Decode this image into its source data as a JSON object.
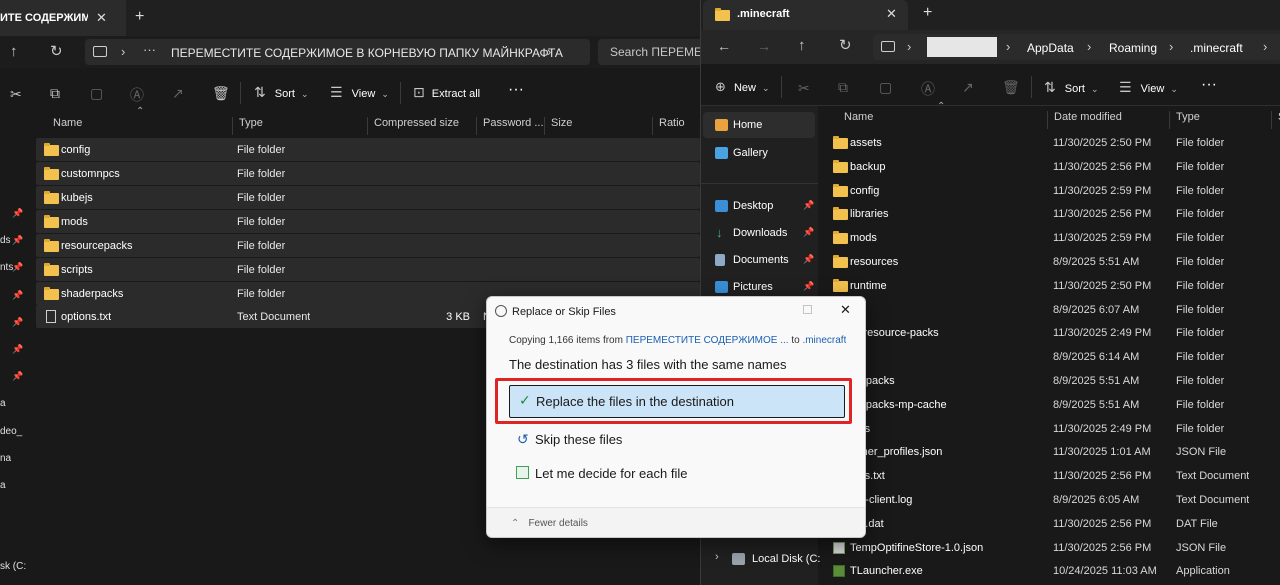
{
  "left": {
    "tab_title": "ИТЕ СОДЕРЖИМО",
    "address": "ПЕРЕМЕСТИТЕ СОДЕРЖИМОЕ В КОРНЕВУЮ ПАПКУ МАЙНКРАФТА",
    "search_placeholder": "Search ПЕРЕМЕС",
    "toolbar": {
      "sort": "Sort",
      "view": "View",
      "extract_all": "Extract all"
    },
    "columns": [
      "Name",
      "Type",
      "Compressed size",
      "Password ...",
      "Size",
      "Ratio"
    ],
    "rows": [
      {
        "name": "config",
        "type": "File folder",
        "size": "",
        "kind": "folder"
      },
      {
        "name": "customnpcs",
        "type": "File folder",
        "size": "",
        "kind": "folder"
      },
      {
        "name": "kubejs",
        "type": "File folder",
        "size": "",
        "kind": "folder"
      },
      {
        "name": "mods",
        "type": "File folder",
        "size": "",
        "kind": "folder"
      },
      {
        "name": "resourcepacks",
        "type": "File folder",
        "size": "",
        "kind": "folder"
      },
      {
        "name": "scripts",
        "type": "File folder",
        "size": "",
        "kind": "folder"
      },
      {
        "name": "shaderpacks",
        "type": "File folder",
        "size": "",
        "kind": "folder"
      },
      {
        "name": "options.txt",
        "type": "Text Document",
        "size": "3 KB",
        "kind": "file"
      }
    ],
    "sidebar_fragments": [
      "ds",
      "nts",
      "a",
      "deo_",
      "na",
      "a",
      "sk (C:"
    ],
    "row_extra": "N"
  },
  "right": {
    "tab_title": ".minecraft",
    "breadcrumb": [
      "AppData",
      "Roaming",
      ".minecraft"
    ],
    "toolbar": {
      "new": "New",
      "sort": "Sort",
      "view": "View"
    },
    "columns": [
      "Name",
      "Date modified",
      "Type",
      "S"
    ],
    "sidebar": [
      {
        "label": "Home",
        "icon": "home-icon",
        "color": "#e8a33d"
      },
      {
        "label": "Gallery",
        "icon": "gallery-icon",
        "color": "#4aa3e0"
      },
      {
        "label": "Desktop",
        "icon": "desktop-icon",
        "color": "#3a8fd8"
      },
      {
        "label": "Downloads",
        "icon": "downloads-icon",
        "color": "#3fb27f"
      },
      {
        "label": "Documents",
        "icon": "documents-icon",
        "color": "#8fa9c8"
      },
      {
        "label": "Pictures",
        "icon": "pictures-icon",
        "color": "#3a8fd8"
      },
      {
        "label": "Local Disk (C:",
        "icon": "disk-icon",
        "color": "#9aa3ad"
      }
    ],
    "rows": [
      {
        "name": "assets",
        "date": "11/30/2025 2:50 PM",
        "type": "File folder",
        "kind": "folder"
      },
      {
        "name": "backup",
        "date": "11/30/2025 2:56 PM",
        "type": "File folder",
        "kind": "folder"
      },
      {
        "name": "config",
        "date": "11/30/2025 2:59 PM",
        "type": "File folder",
        "kind": "folder"
      },
      {
        "name": "libraries",
        "date": "11/30/2025 2:56 PM",
        "type": "File folder",
        "kind": "folder"
      },
      {
        "name": "mods",
        "date": "11/30/2025 2:59 PM",
        "type": "File folder",
        "kind": "folder"
      },
      {
        "name": "resources",
        "date": "8/9/2025 5:51 AM",
        "type": "File folder",
        "kind": "folder"
      },
      {
        "name": "runtime",
        "date": "11/30/2025 2:50 PM",
        "type": "File folder",
        "kind": "folder"
      },
      {
        "name": "es",
        "date": "8/9/2025 6:07 AM",
        "type": "File folder",
        "kind": "hidden"
      },
      {
        "name": "er-resource-packs",
        "date": "11/30/2025 2:49 PM",
        "type": "File folder",
        "kind": "hidden"
      },
      {
        "name": "s",
        "date": "8/9/2025 6:14 AM",
        "type": "File folder",
        "kind": "hidden"
      },
      {
        "name": "urepacks",
        "date": "8/9/2025 5:51 AM",
        "type": "File folder",
        "kind": "hidden"
      },
      {
        "name": "urepacks-mp-cache",
        "date": "8/9/2025 5:51 AM",
        "type": "File folder",
        "kind": "hidden"
      },
      {
        "name": "ions",
        "date": "11/30/2025 2:49 PM",
        "type": "File folder",
        "kind": "hidden"
      },
      {
        "name": "ncher_profiles.json",
        "date": "11/30/2025 1:01 AM",
        "type": "JSON File",
        "kind": "hidden"
      },
      {
        "name": "ions.txt",
        "date": "11/30/2025 2:56 PM",
        "type": "Text Document",
        "kind": "hidden"
      },
      {
        "name": "put-client.log",
        "date": "8/9/2025 6:05 AM",
        "type": "Text Document",
        "kind": "hidden"
      },
      {
        "name": "ers.dat",
        "date": "11/30/2025 2:56 PM",
        "type": "DAT File",
        "kind": "hidden"
      },
      {
        "name": "TempOptifineStore-1.0.json",
        "date": "11/30/2025 2:56 PM",
        "type": "JSON File",
        "kind": "file"
      },
      {
        "name": "TLauncher.exe",
        "date": "10/24/2025 11:03 AM",
        "type": "Application",
        "kind": "exe"
      }
    ]
  },
  "dialog": {
    "title": "Replace or Skip Files",
    "copying_prefix": "Copying 1,166 items from",
    "copying_source": "ПЕРЕМЕСТИТЕ СОДЕРЖИМОЕ ...",
    "copying_to": "to",
    "copying_dest": ".minecraft",
    "heading": "The destination has 3 files with the same names",
    "option_replace": "Replace the files in the destination",
    "option_skip": "Skip these files",
    "option_decide": "Let me decide for each file",
    "fewer_details": "Fewer details",
    "colors": {
      "highlight": "#e02424",
      "selected_bg": "#cce4f7",
      "link": "#1a5fb4"
    }
  }
}
